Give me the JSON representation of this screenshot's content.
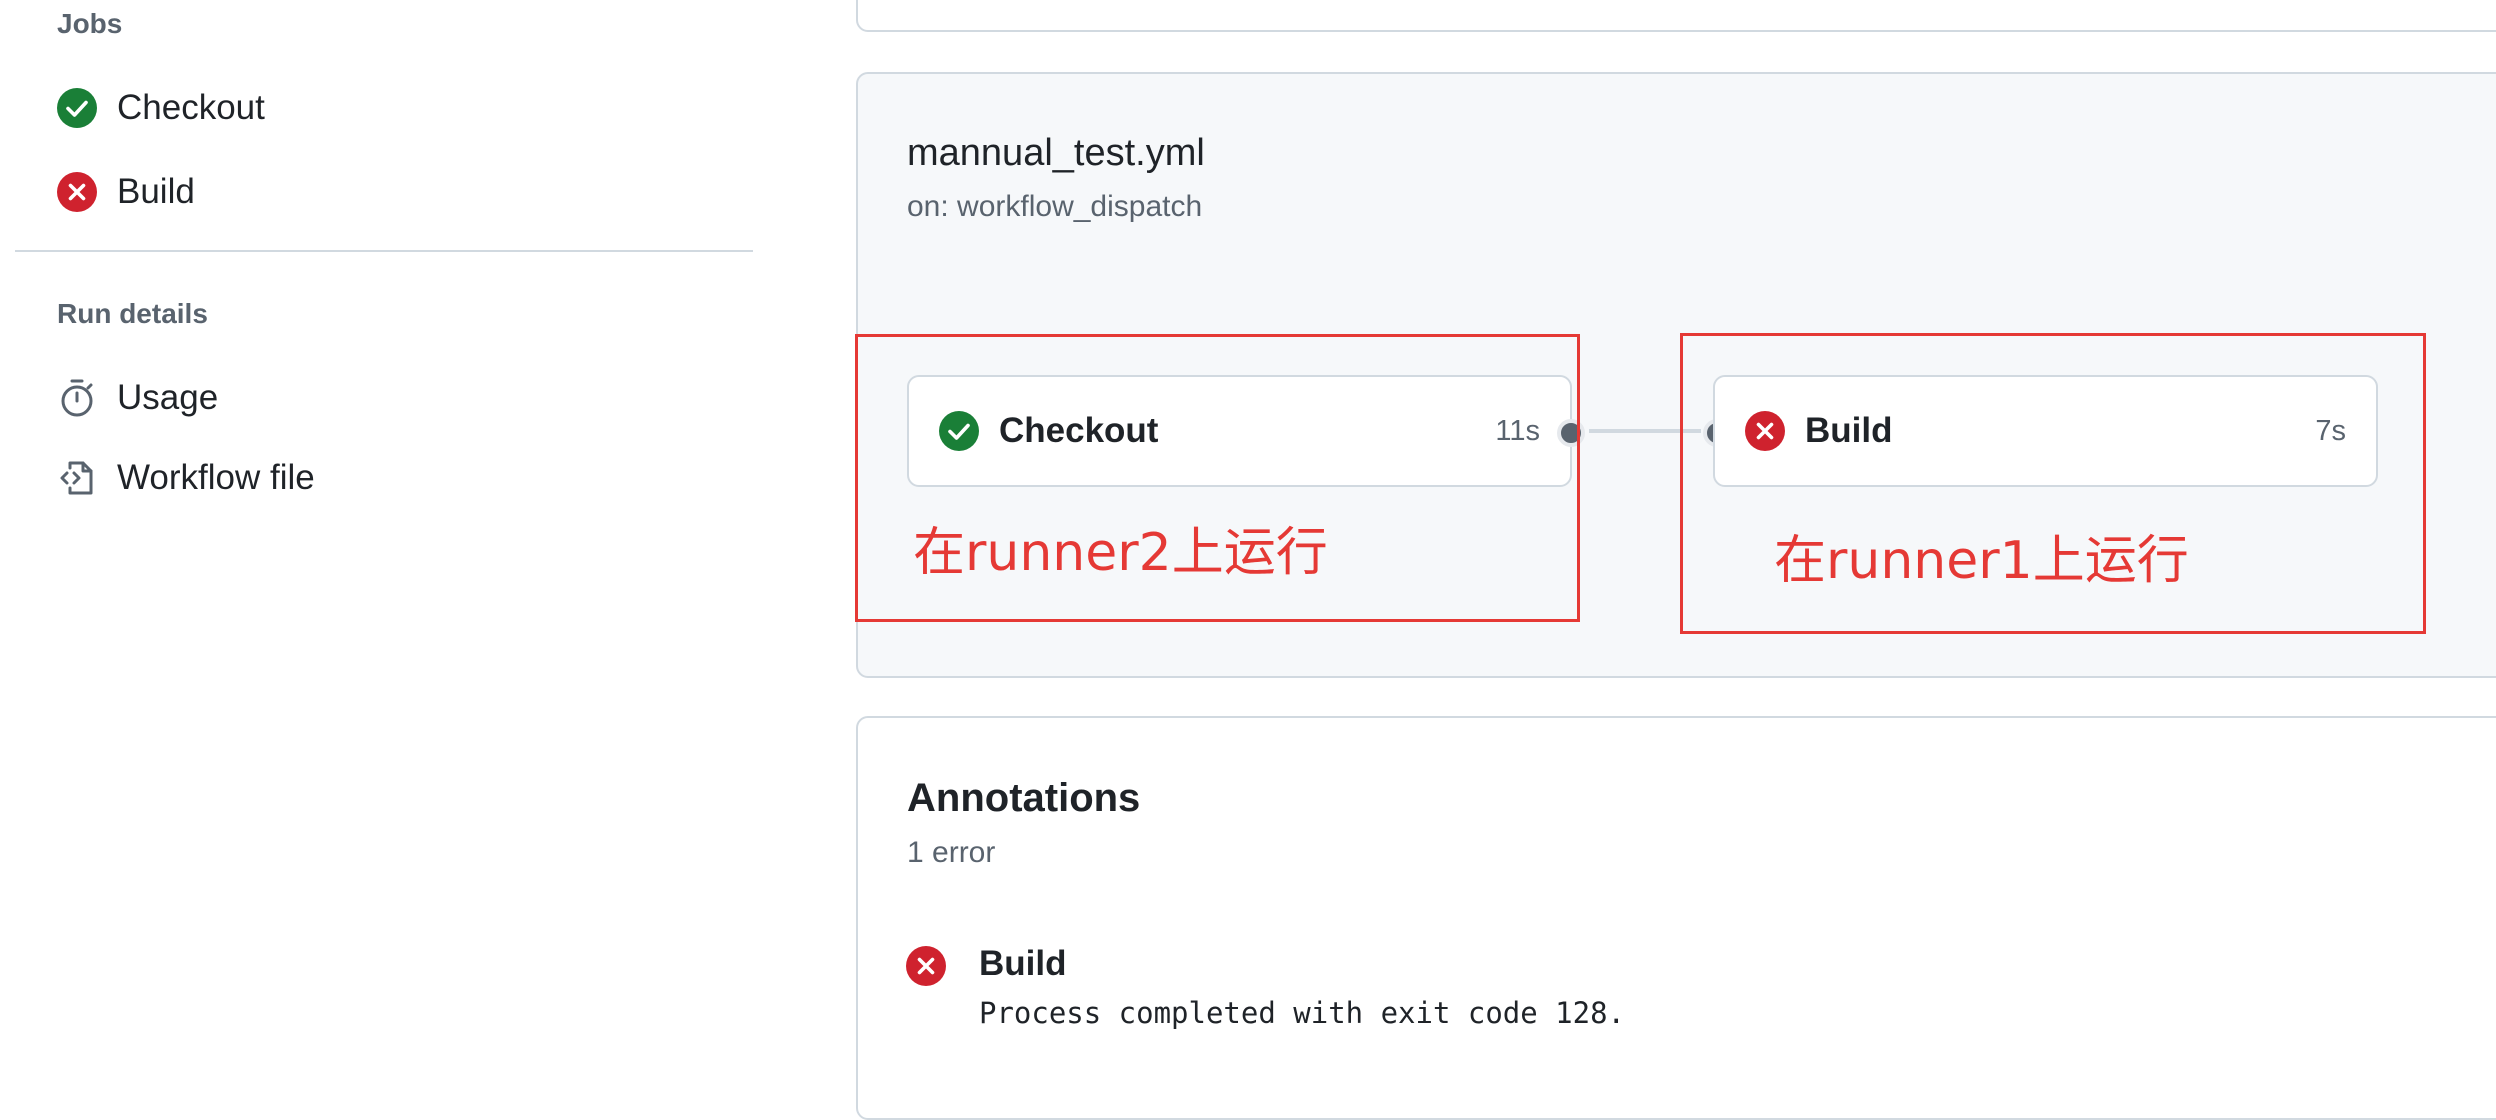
{
  "sidebar": {
    "jobs_heading": "Jobs",
    "jobs": [
      {
        "label": "Checkout",
        "status": "success"
      },
      {
        "label": "Build",
        "status": "failure"
      }
    ],
    "run_details_heading": "Run details",
    "run_details": [
      {
        "label": "Usage",
        "icon": "stopwatch-icon"
      },
      {
        "label": "Workflow file",
        "icon": "file-code-icon"
      }
    ]
  },
  "workflow": {
    "file_name": "mannual_test.yml",
    "trigger": "on: workflow_dispatch",
    "jobs": [
      {
        "name": "Checkout",
        "duration": "11s",
        "status": "success",
        "note": "在runner2上运行"
      },
      {
        "name": "Build",
        "duration": "7s",
        "status": "failure",
        "note": "在runner1上运行"
      }
    ]
  },
  "annotations": {
    "title": "Annotations",
    "count": "1 error",
    "items": [
      {
        "title": "Build",
        "message": "Process completed with exit code 128.",
        "level": "error"
      }
    ]
  },
  "colors": {
    "success": "#1a7f37",
    "failure": "#cf222e",
    "annotation_red": "#e53935",
    "panel_bg": "#f6f8fa",
    "border": "#d1d9e0"
  }
}
